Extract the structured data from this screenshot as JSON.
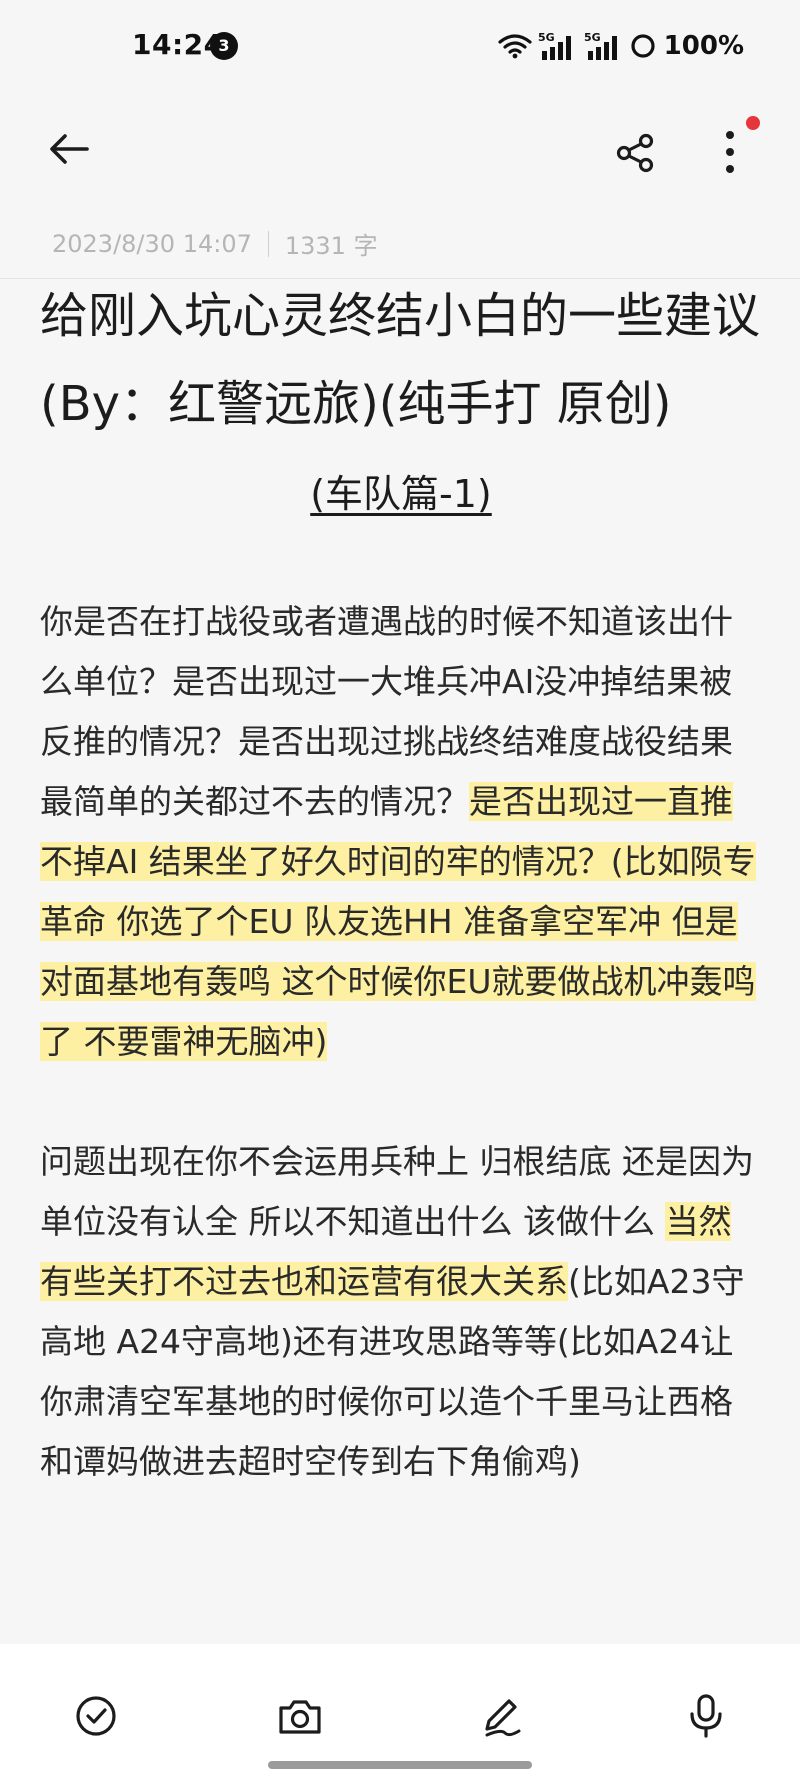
{
  "status_bar": {
    "time": "14:24",
    "notification_count": "3",
    "battery_percent": "100%",
    "signal_labels": [
      "5G",
      "5G"
    ]
  },
  "toolbar": {
    "back_icon": "back-arrow-icon",
    "share_icon": "share-icon",
    "more_icon": "more-vertical-icon",
    "has_unread_dot": true,
    "dot_color": "#e5363b"
  },
  "note": {
    "datetime": "2023/8/30 14:07",
    "word_count": "1331 字",
    "title": "给刚入坑心灵终结小白的一些建议(By：红警远旅)(纯手打 原创)",
    "section_heading": "(车队篇-1)",
    "para1": {
      "plain": "你是否在打战役或者遭遇战的时候不知道该出什么单位？是否出现过一大堆兵冲AI没冲掉结果被反推的情况？是否出现过挑战终结难度战役结果最简单的关都过不去的情况？",
      "highlighted": "是否出现过一直推不掉AI 结果坐了好久时间的牢的情况？(比如陨专革命 你选了个EU 队友选HH 准备拿空军冲 但是对面基地有轰鸣 这个时候你EU就要做战机冲轰鸣了 不要雷神无脑冲)"
    },
    "para2": {
      "plain_before": "问题出现在你不会运用兵种上 归根结底 还是因为单位没有认全 所以不知道出什么 该做什么 ",
      "highlighted": "当然 有些关打不过去也和运营有很大关系",
      "plain_after": "(比如A23守高地 A24守高地)还有进攻思路等等(比如A24让你肃清空军基地的时候你可以造个千里马让西格和谭妈做进去超时空传到右下角偷鸡)"
    },
    "highlight_color": "#fdf0a3"
  },
  "bottom_bar": {
    "icons": [
      "checkmark-circle-icon",
      "camera-icon",
      "pen-icon",
      "microphone-icon"
    ]
  }
}
